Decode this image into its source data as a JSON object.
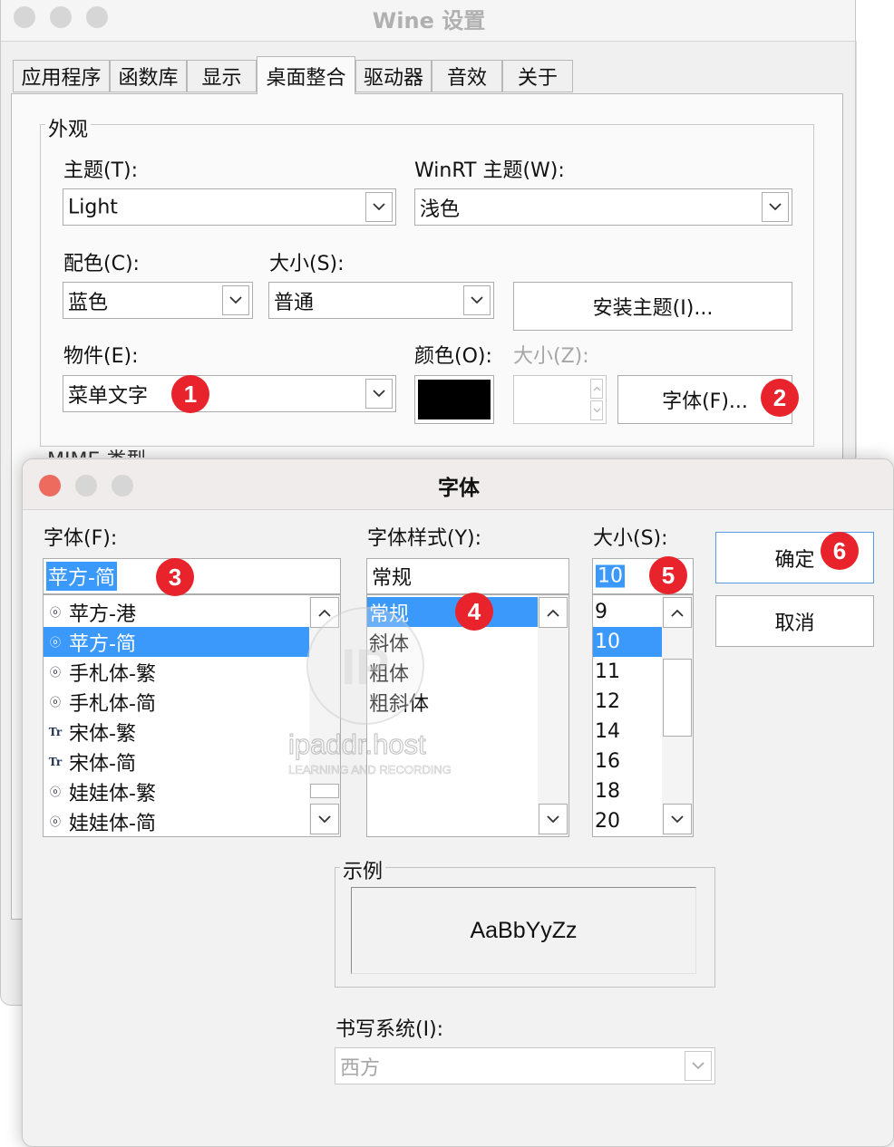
{
  "wine": {
    "title": "Wine 设置",
    "tabs": [
      "应用程序",
      "函数库",
      "显示",
      "桌面整合",
      "驱动器",
      "音效",
      "关于"
    ],
    "appearance_group": "外观",
    "theme_label": "主题(T):",
    "theme_value": "Light",
    "winrt_label": "WinRT 主题(W):",
    "winrt_value": "浅色",
    "scheme_label": "配色(C):",
    "scheme_value": "蓝色",
    "size_label": "大小(S):",
    "size_value": "普通",
    "install_theme": "安装主题(I)...",
    "item_label": "物件(E):",
    "item_value": "菜单文字",
    "color_label": "颜色(O):",
    "item_size_label": "大小(Z):",
    "font_button": "字体(F)...",
    "partial_group": "MIME 类型"
  },
  "font_dialog": {
    "title": "字体",
    "font_label": "字体(F):",
    "font_value": "苹方-简",
    "fonts": [
      "苹方-港",
      "苹方-简",
      "手札体-繁",
      "手札体-简",
      "宋体-繁",
      "宋体-简",
      "娃娃体-繁",
      "娃娃体-简"
    ],
    "style_label": "字体样式(Y):",
    "style_value": "常规",
    "styles": [
      "常规",
      "斜体",
      "粗体",
      "粗斜体"
    ],
    "size_label": "大小(S):",
    "size_value": "10",
    "sizes": [
      "9",
      "10",
      "11",
      "12",
      "14",
      "16",
      "18",
      "20"
    ],
    "ok": "确定",
    "cancel": "取消",
    "sample_group": "示例",
    "sample_text": "AaBbYyZz",
    "script_label": "书写系统(I):",
    "script_value": "西方"
  },
  "badges": [
    "1",
    "2",
    "3",
    "4",
    "5",
    "6"
  ],
  "watermark": {
    "main": "ipaddr.host",
    "sub": "LEARNING AND RECORDING",
    "logo": "IP"
  },
  "colors": {
    "selection": "#3b99fc",
    "badge": "#e8232b",
    "close": "#ed6a5e",
    "swatch": "#000000"
  }
}
